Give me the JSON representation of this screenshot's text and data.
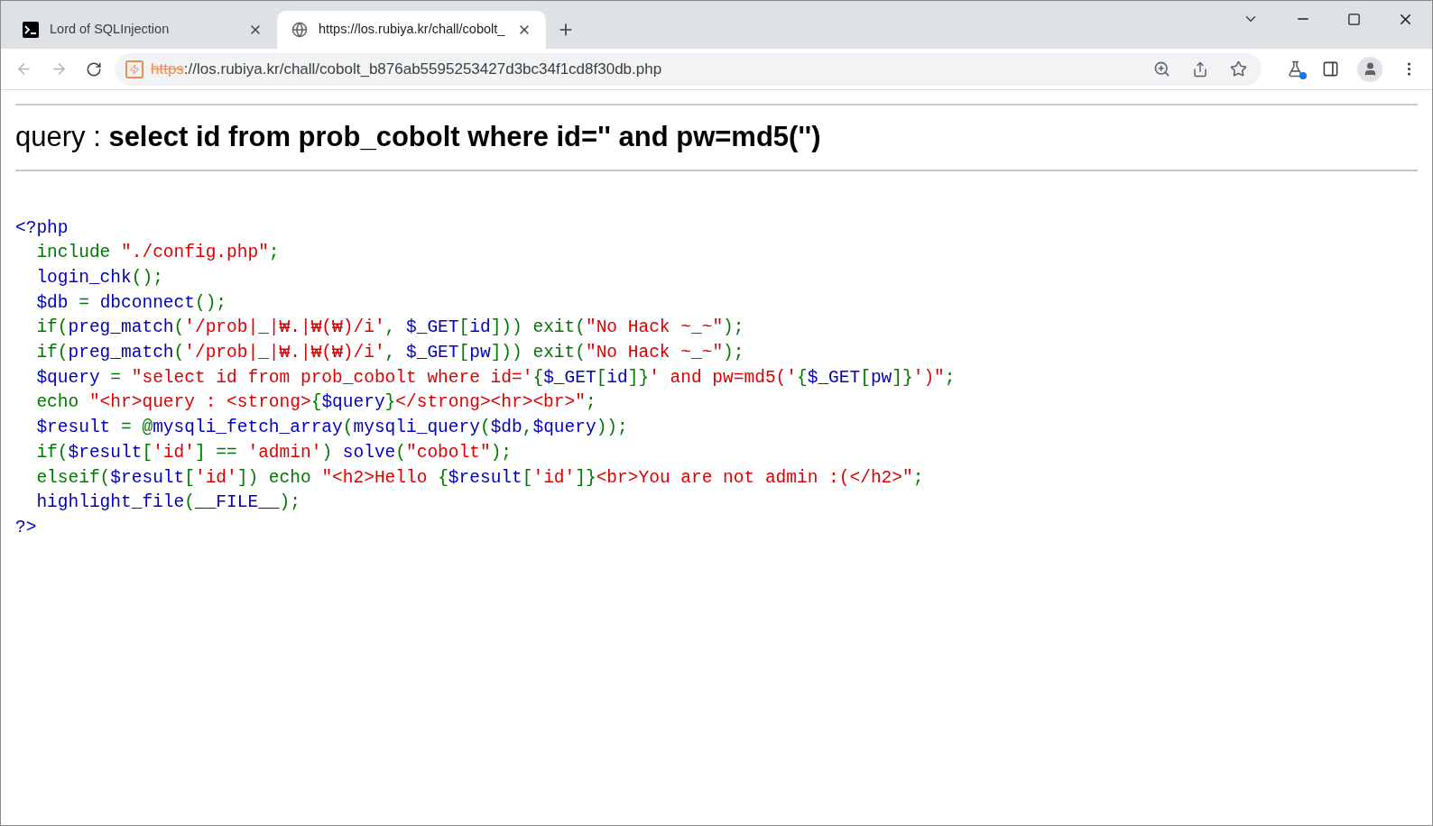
{
  "tabs": [
    {
      "kind": "terminal",
      "title": "Lord of SQLInjection",
      "selected": false
    },
    {
      "kind": "globe",
      "title": "https://los.rubiya.kr/chall/cobolt_",
      "selected": true
    }
  ],
  "address_bar": {
    "scheme": "https",
    "rest": "://los.rubiya.kr/chall/cobolt_b876ab5595253427d3bc34f1cd8f30db.php"
  },
  "page": {
    "heading": "query : **select id from prob_cobolt where id='' and pw=md5('')**",
    "code_lines": [
      {
        "segments": [
          {
            "kind": "default",
            "text": "<?php"
          }
        ]
      },
      {
        "segments": [
          {
            "kind": "keyword",
            "text": "  include "
          },
          {
            "kind": "string",
            "text": "\"./config.php\""
          },
          {
            "kind": "keyword",
            "text": ";"
          }
        ]
      },
      {
        "segments": [
          {
            "kind": "default",
            "text": "  login_chk"
          },
          {
            "kind": "keyword",
            "text": "();"
          }
        ]
      },
      {
        "segments": [
          {
            "kind": "default",
            "text": "  $db "
          },
          {
            "kind": "keyword",
            "text": "= "
          },
          {
            "kind": "default",
            "text": "dbconnect"
          },
          {
            "kind": "keyword",
            "text": "();"
          }
        ]
      },
      {
        "segments": [
          {
            "kind": "keyword",
            "text": "  if("
          },
          {
            "kind": "default",
            "text": "preg_match"
          },
          {
            "kind": "keyword",
            "text": "("
          },
          {
            "kind": "string",
            "text": "'/prob|_|₩.|₩(₩)/i'"
          },
          {
            "kind": "keyword",
            "text": ", "
          },
          {
            "kind": "default",
            "text": "$_GET"
          },
          {
            "kind": "keyword",
            "text": "["
          },
          {
            "kind": "default",
            "text": "id"
          },
          {
            "kind": "keyword",
            "text": "])) exit("
          },
          {
            "kind": "string",
            "text": "\"No Hack ~_~\""
          },
          {
            "kind": "keyword",
            "text": ");"
          }
        ]
      },
      {
        "segments": [
          {
            "kind": "keyword",
            "text": "  if("
          },
          {
            "kind": "default",
            "text": "preg_match"
          },
          {
            "kind": "keyword",
            "text": "("
          },
          {
            "kind": "string",
            "text": "'/prob|_|₩.|₩(₩)/i'"
          },
          {
            "kind": "keyword",
            "text": ", "
          },
          {
            "kind": "default",
            "text": "$_GET"
          },
          {
            "kind": "keyword",
            "text": "["
          },
          {
            "kind": "default",
            "text": "pw"
          },
          {
            "kind": "keyword",
            "text": "])) exit("
          },
          {
            "kind": "string",
            "text": "\"No Hack ~_~\""
          },
          {
            "kind": "keyword",
            "text": ");"
          }
        ]
      },
      {
        "segments": [
          {
            "kind": "default",
            "text": "  $query "
          },
          {
            "kind": "keyword",
            "text": "= "
          },
          {
            "kind": "string",
            "text": "\"select id from prob_cobolt where id='"
          },
          {
            "kind": "keyword",
            "text": "{"
          },
          {
            "kind": "default",
            "text": "$_GET"
          },
          {
            "kind": "keyword",
            "text": "["
          },
          {
            "kind": "default",
            "text": "id"
          },
          {
            "kind": "keyword",
            "text": "]}"
          },
          {
            "kind": "string",
            "text": "' and pw=md5('"
          },
          {
            "kind": "keyword",
            "text": "{"
          },
          {
            "kind": "default",
            "text": "$_GET"
          },
          {
            "kind": "keyword",
            "text": "["
          },
          {
            "kind": "default",
            "text": "pw"
          },
          {
            "kind": "keyword",
            "text": "]}"
          },
          {
            "kind": "string",
            "text": "')\""
          },
          {
            "kind": "keyword",
            "text": ";"
          }
        ]
      },
      {
        "segments": [
          {
            "kind": "keyword",
            "text": "  echo "
          },
          {
            "kind": "string",
            "text": "\"<hr>query : <strong>"
          },
          {
            "kind": "keyword",
            "text": "{"
          },
          {
            "kind": "default",
            "text": "$query"
          },
          {
            "kind": "keyword",
            "text": "}"
          },
          {
            "kind": "string",
            "text": "</strong><hr><br>\""
          },
          {
            "kind": "keyword",
            "text": ";"
          }
        ]
      },
      {
        "segments": [
          {
            "kind": "default",
            "text": "  $result "
          },
          {
            "kind": "keyword",
            "text": "= @"
          },
          {
            "kind": "default",
            "text": "mysqli_fetch_array"
          },
          {
            "kind": "keyword",
            "text": "("
          },
          {
            "kind": "default",
            "text": "mysqli_query"
          },
          {
            "kind": "keyword",
            "text": "("
          },
          {
            "kind": "default",
            "text": "$db"
          },
          {
            "kind": "keyword",
            "text": ","
          },
          {
            "kind": "default",
            "text": "$query"
          },
          {
            "kind": "keyword",
            "text": "));"
          }
        ]
      },
      {
        "segments": [
          {
            "kind": "keyword",
            "text": "  if("
          },
          {
            "kind": "default",
            "text": "$result"
          },
          {
            "kind": "keyword",
            "text": "["
          },
          {
            "kind": "string",
            "text": "'id'"
          },
          {
            "kind": "keyword",
            "text": "] == "
          },
          {
            "kind": "string",
            "text": "'admin'"
          },
          {
            "kind": "keyword",
            "text": ") "
          },
          {
            "kind": "default",
            "text": "solve"
          },
          {
            "kind": "keyword",
            "text": "("
          },
          {
            "kind": "string",
            "text": "\"cobolt\""
          },
          {
            "kind": "keyword",
            "text": ");"
          }
        ]
      },
      {
        "segments": [
          {
            "kind": "keyword",
            "text": "  elseif("
          },
          {
            "kind": "default",
            "text": "$result"
          },
          {
            "kind": "keyword",
            "text": "["
          },
          {
            "kind": "string",
            "text": "'id'"
          },
          {
            "kind": "keyword",
            "text": "]) echo "
          },
          {
            "kind": "string",
            "text": "\"<h2>Hello "
          },
          {
            "kind": "keyword",
            "text": "{"
          },
          {
            "kind": "default",
            "text": "$result"
          },
          {
            "kind": "keyword",
            "text": "["
          },
          {
            "kind": "string",
            "text": "'id'"
          },
          {
            "kind": "keyword",
            "text": "]}"
          },
          {
            "kind": "string",
            "text": "<br>You are not admin :(</h2>\""
          },
          {
            "kind": "keyword",
            "text": ";"
          }
        ]
      },
      {
        "segments": [
          {
            "kind": "default",
            "text": "  highlight_file"
          },
          {
            "kind": "keyword",
            "text": "("
          },
          {
            "kind": "default",
            "text": "__FILE__"
          },
          {
            "kind": "keyword",
            "text": ");"
          }
        ]
      },
      {
        "segments": [
          {
            "kind": "default",
            "text": "?>"
          }
        ]
      }
    ]
  }
}
